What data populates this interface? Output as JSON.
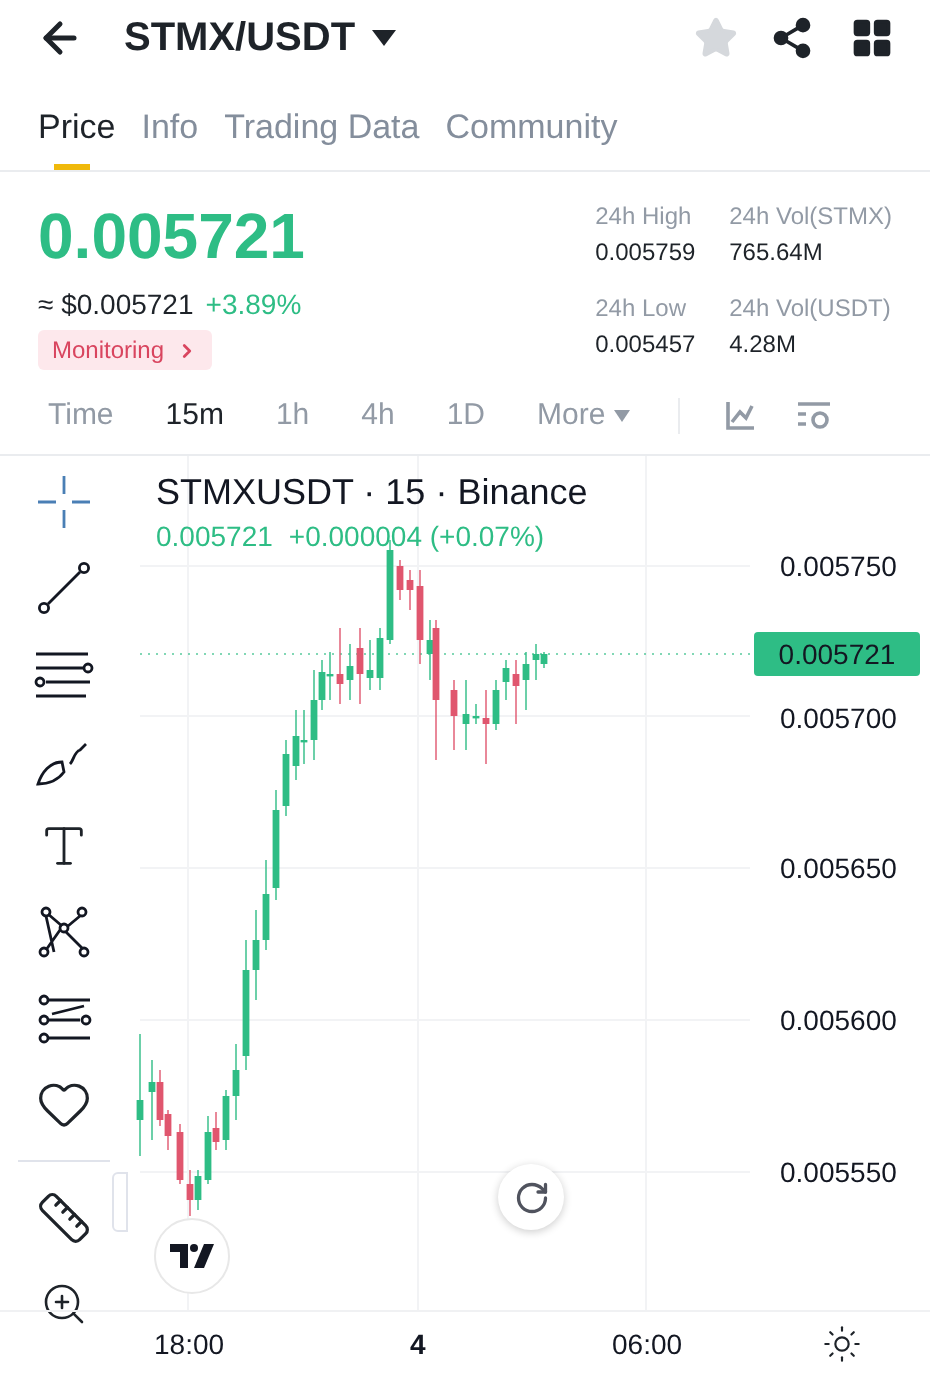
{
  "header": {
    "title": "STMX/USDT"
  },
  "tabs": [
    {
      "label": "Price",
      "selected": true
    },
    {
      "label": "Info",
      "selected": false
    },
    {
      "label": "Trading Data",
      "selected": false
    },
    {
      "label": "Community",
      "selected": false
    }
  ],
  "price": {
    "last": "0.005721",
    "fiat": "≈ $0.005721",
    "change": "+3.89%",
    "badge": "Monitoring"
  },
  "stats": [
    {
      "label": "24h High",
      "value": "0.005759"
    },
    {
      "label": "24h Vol(STMX)",
      "value": "765.64M"
    },
    {
      "label": "24h Low",
      "value": "0.005457"
    },
    {
      "label": "24h Vol(USDT)",
      "value": "4.28M"
    }
  ],
  "intervals": [
    {
      "label": "Time",
      "selected": false,
      "kind": "interval"
    },
    {
      "label": "15m",
      "selected": true,
      "kind": "interval"
    },
    {
      "label": "1h",
      "selected": false,
      "kind": "interval"
    },
    {
      "label": "4h",
      "selected": false,
      "kind": "interval"
    },
    {
      "label": "1D",
      "selected": false,
      "kind": "interval"
    },
    {
      "label": "More",
      "selected": false,
      "kind": "menu"
    }
  ],
  "chart": {
    "title": "STMXUSDT · 15 · Binance",
    "last": "0.005721",
    "change": "+0.000004 (+0.07%)",
    "price_axis": [
      "0.005750",
      "0.005700",
      "0.005650",
      "0.005600",
      "0.005550"
    ],
    "current_price": "0.005721",
    "time_axis": [
      {
        "label": "18:00",
        "bold": false
      },
      {
        "label": "4",
        "bold": true
      },
      {
        "label": "06:00",
        "bold": false
      }
    ]
  }
}
